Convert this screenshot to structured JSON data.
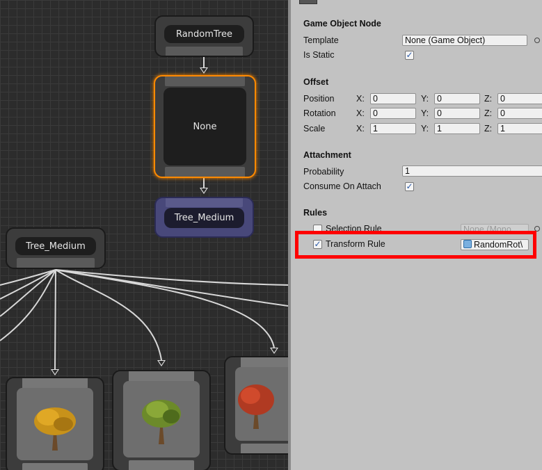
{
  "graph": {
    "nodes": {
      "random_tree": "RandomTree",
      "none_node": "None",
      "tree_medium_purple": "Tree_Medium",
      "tree_medium_left": "Tree_Medium"
    }
  },
  "inspector": {
    "game_object_node": {
      "title": "Game Object Node",
      "template_label": "Template",
      "template_value": "None (Game Object)",
      "is_static_label": "Is Static",
      "is_static_checked": "✓"
    },
    "offset": {
      "title": "Offset",
      "position_label": "Position",
      "rotation_label": "Rotation",
      "scale_label": "Scale",
      "x_label": "X:",
      "y_label": "Y:",
      "z_label": "Z:",
      "position": {
        "x": "0",
        "y": "0",
        "z": "0"
      },
      "rotation": {
        "x": "0",
        "y": "0",
        "z": "0"
      },
      "scale": {
        "x": "1",
        "y": "1",
        "z": "1"
      }
    },
    "attachment": {
      "title": "Attachment",
      "probability_label": "Probability",
      "probability_value": "1",
      "consume_label": "Consume On Attach",
      "consume_checked": "✓"
    },
    "rules": {
      "title": "Rules",
      "selection_rule_label": "Selection Rule",
      "selection_rule_value": "None (Mono",
      "transform_rule_label": "Transform Rule",
      "transform_rule_checked": "✓",
      "transform_rule_value": "RandomRot\\"
    }
  }
}
